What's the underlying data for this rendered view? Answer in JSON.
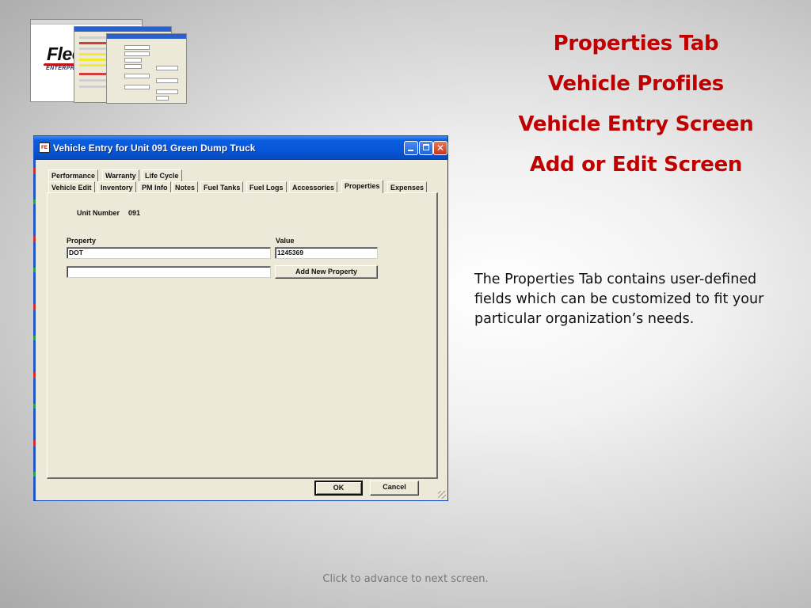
{
  "slide": {
    "titles": [
      "Properties Tab",
      "Vehicle Profiles",
      "Vehicle Entry Screen",
      "Add or Edit Screen"
    ],
    "description": "The Properties Tab contains  user-defined fields which can be customized to fit your particular organization’s needs.",
    "footer": "Click to advance to next screen.",
    "title_color": "#c00000"
  },
  "thumbnail": {
    "logo_text": "Flee",
    "logo_subtext": "ENTERPRIS"
  },
  "window": {
    "title": "Vehicle Entry for Unit 091 Green Dump Truck",
    "icons": {
      "app": "fleet-app-icon",
      "minimize": "minimize-icon",
      "maximize": "maximize-icon",
      "close": "close-icon"
    },
    "tabs_row1": [
      "Performance",
      "Warranty",
      "Life Cycle"
    ],
    "tabs_row2": [
      "Vehicle Edit",
      "Inventory",
      "PM Info",
      "Notes",
      "Fuel Tanks",
      "Fuel Logs",
      "Accessories",
      "Properties",
      "Expenses"
    ],
    "active_tab": "Properties",
    "unit_number_label": "Unit Number",
    "unit_number_value": "091",
    "property_header": "Property",
    "value_header": "Value",
    "rows": [
      {
        "property": "DOT",
        "value": "1245369"
      }
    ],
    "new_property_value": "",
    "add_button": "Add New Property",
    "ok_button": "OK",
    "cancel_button": "Cancel",
    "titlebar_color": "#0757d8"
  }
}
